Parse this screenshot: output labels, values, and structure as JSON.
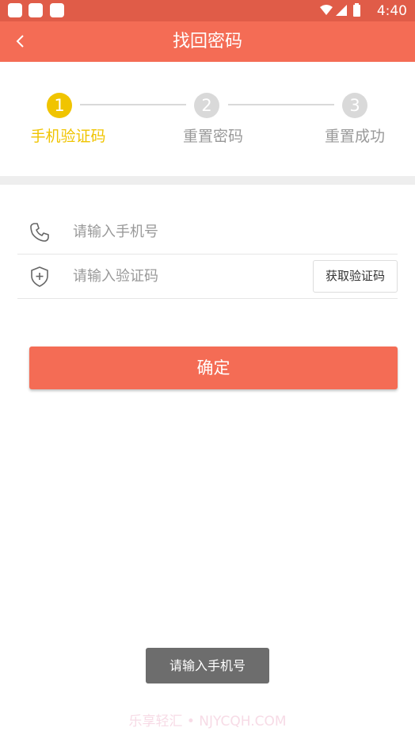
{
  "status_bar": {
    "time": "4:40"
  },
  "header": {
    "title": "找回密码",
    "back_icon": "chevron-left-icon"
  },
  "steps": [
    {
      "number": "1",
      "label": "手机验证码",
      "state": "active"
    },
    {
      "number": "2",
      "label": "重置密码",
      "state": "inactive"
    },
    {
      "number": "3",
      "label": "重置成功",
      "state": "inactive"
    }
  ],
  "form": {
    "phone": {
      "icon": "phone-icon",
      "placeholder": "请输入手机号",
      "value": ""
    },
    "code": {
      "icon": "shield-plus-icon",
      "placeholder": "请输入验证码",
      "value": "",
      "button_label": "获取验证码"
    },
    "confirm_label": "确定"
  },
  "toast": {
    "message": "请输入手机号"
  },
  "watermark": "乐享轻汇 • NJYCQH.COM",
  "colors": {
    "accent": "#f46c55",
    "status_bar": "#e05c48",
    "active_step": "#f0c400",
    "inactive_step": "#d9d9d9"
  }
}
